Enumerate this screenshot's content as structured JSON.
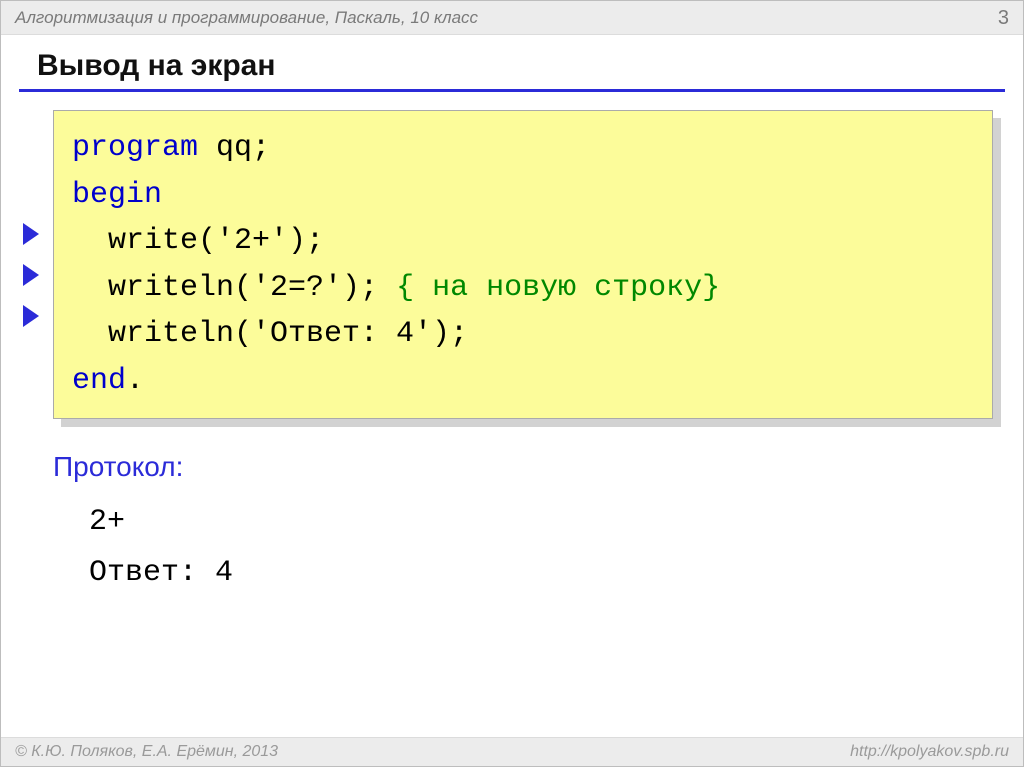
{
  "header": {
    "subject": "Алгоритмизация и программирование, Паскаль, 10 класс",
    "page_number": "3"
  },
  "title": "Вывод на экран",
  "code": {
    "line1_kw": "program",
    "line1_rest": " qq;",
    "line2_kw": "begin",
    "line3": "  write('2+');",
    "line4_a": "  writeln('2=?'); ",
    "line4_comment": "{ на новую строку}",
    "line5": "  writeln('Ответ: 4');",
    "line6_kw": "end",
    "line6_rest": "."
  },
  "protocol": {
    "label": "Протокол:",
    "out1": "2+",
    "out2": "Ответ: 4"
  },
  "footer": {
    "copyright": "© К.Ю. Поляков, Е.А. Ерёмин, 2013",
    "url": "http://kpolyakov.spb.ru"
  }
}
